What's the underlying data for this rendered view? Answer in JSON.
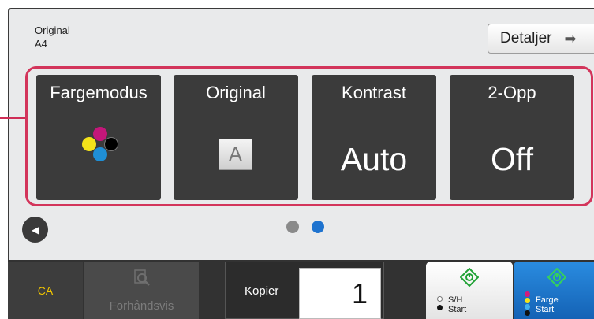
{
  "header": {
    "original_label": "Original",
    "original_size": "A4",
    "details_label": "Detaljer",
    "details_icon": "arrow-right-icon"
  },
  "tiles": [
    {
      "label": "Fargemodus",
      "value": "",
      "icon": "cmyk-dots-icon"
    },
    {
      "label": "Original",
      "value": "A",
      "icon": "original-a-icon"
    },
    {
      "label": "Kontrast",
      "value": "Auto"
    },
    {
      "label": "2-Opp",
      "value": "Off"
    }
  ],
  "pager": {
    "active_page": 2,
    "total_pages": 2,
    "prev_icon": "triangle-left-icon"
  },
  "bottom": {
    "ca_label": "CA",
    "preview_label": "Forhåndsvis",
    "preview_icon": "magnifier-icon",
    "copies_label": "Kopier",
    "copies_value": "1",
    "bw_start_line1": "S/H",
    "bw_start_line2": "Start",
    "color_start_line1": "Farge",
    "color_start_line2": "Start"
  },
  "colors": {
    "accent": "#d3355b",
    "tile_bg": "#3b3b3b",
    "ca_text": "#f2c600",
    "start_bw": "#21a236",
    "start_color": "#1462b5",
    "page_dot_active": "#1e73cf",
    "page_dot_inactive": "#8a8a8a"
  }
}
